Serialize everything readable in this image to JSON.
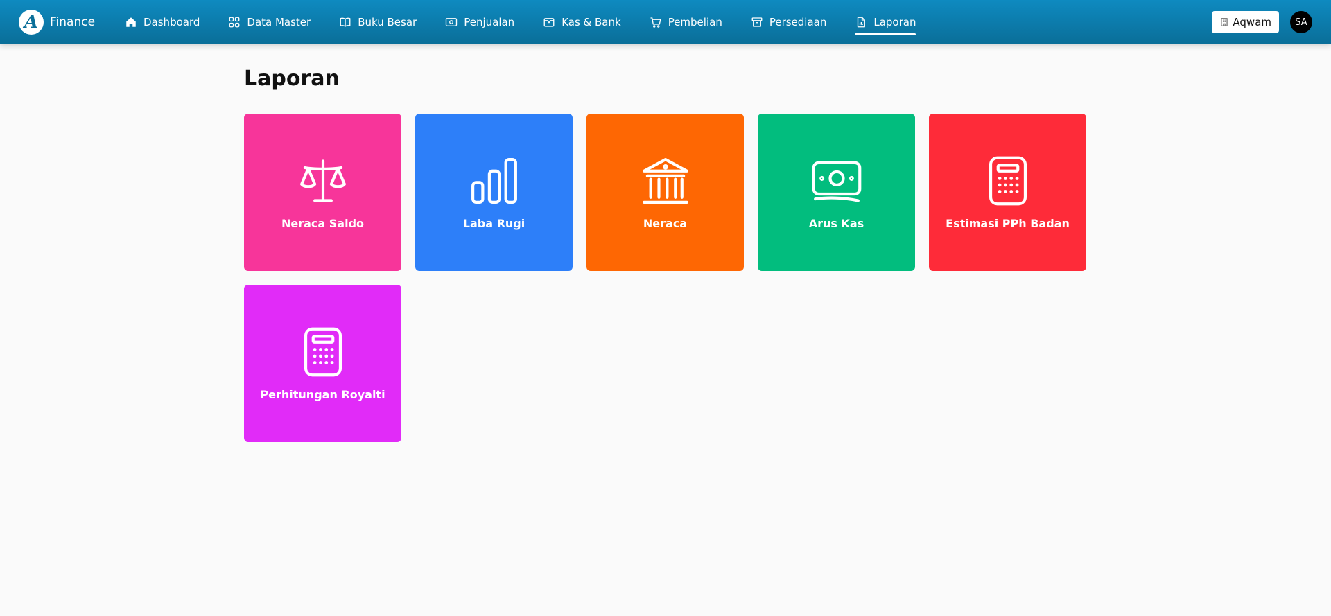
{
  "brand": {
    "logo_letter": "A",
    "name": "Finance"
  },
  "nav": [
    {
      "label": "Dashboard",
      "icon": "home-icon",
      "active": false
    },
    {
      "label": "Data Master",
      "icon": "grid-icon",
      "active": false
    },
    {
      "label": "Buku Besar",
      "icon": "book-icon",
      "active": false
    },
    {
      "label": "Penjualan",
      "icon": "money-icon",
      "active": false
    },
    {
      "label": "Kas & Bank",
      "icon": "wallet-icon",
      "active": false
    },
    {
      "label": "Pembelian",
      "icon": "cart-icon",
      "active": false
    },
    {
      "label": "Persediaan",
      "icon": "archive-icon",
      "active": false
    },
    {
      "label": "Laporan",
      "icon": "report-icon",
      "active": true
    }
  ],
  "user": {
    "tenant": "Aqwam",
    "initials": "SA"
  },
  "page": {
    "title": "Laporan"
  },
  "reports": [
    {
      "label": "Neraca Saldo",
      "icon": "scale-icon",
      "color": "#f7359a"
    },
    {
      "label": "Laba Rugi",
      "icon": "bar-chart-icon",
      "color": "#2d7ff9"
    },
    {
      "label": "Neraca",
      "icon": "bank-icon",
      "color": "#fe6703"
    },
    {
      "label": "Arus Kas",
      "icon": "cash-icon",
      "color": "#02bd7e"
    },
    {
      "label": "Estimasi PPh Badan",
      "icon": "calculator-icon",
      "color": "#fe2b39"
    },
    {
      "label": "Perhitungan Royalti",
      "icon": "calculator-icon",
      "color": "#e12bf8"
    }
  ]
}
